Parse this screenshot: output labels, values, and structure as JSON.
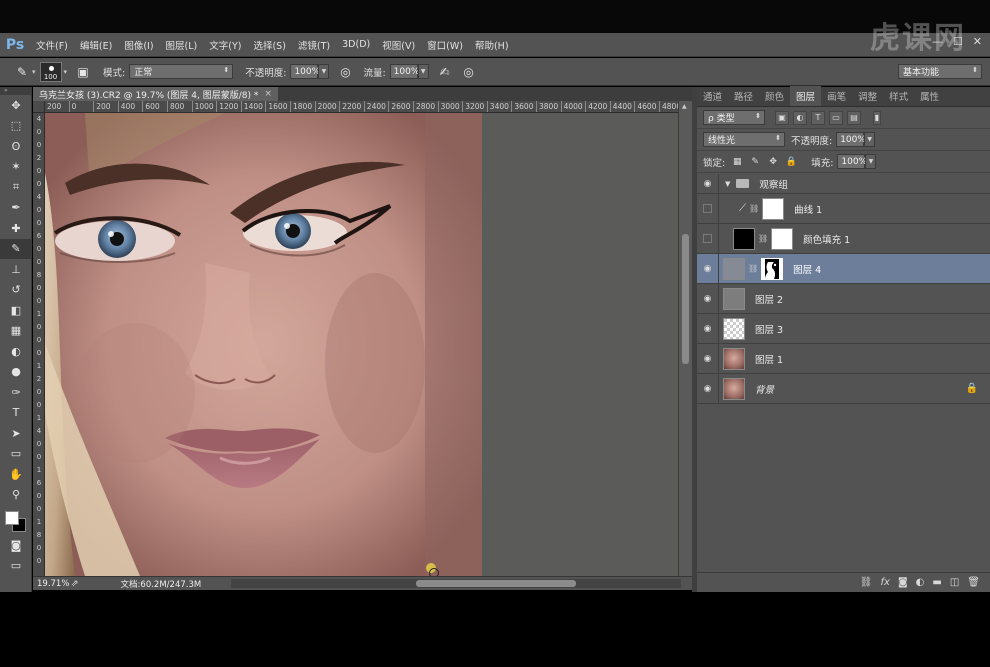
{
  "app": {
    "logo": "Ps"
  },
  "menu": [
    "文件(F)",
    "编辑(E)",
    "图像(I)",
    "图层(L)",
    "文字(Y)",
    "选择(S)",
    "滤镜(T)",
    "3D(D)",
    "视图(V)",
    "窗口(W)",
    "帮助(H)"
  ],
  "watermark": "虎课网",
  "window_controls": [
    "—",
    "☐",
    "✕"
  ],
  "options": {
    "brush_size": "100",
    "mode_label": "模式:",
    "mode_value": "正常",
    "opacity_label": "不透明度:",
    "opacity_value": "100%",
    "flow_label": "流量:",
    "flow_value": "100%",
    "workspace": "基本功能"
  },
  "document": {
    "tab_title": "乌克兰女孩 (3).CR2 @ 19.7% (图层 4, 图层蒙版/8) *",
    "close": "×",
    "ruler_top": [
      "200",
      "0",
      "200",
      "400",
      "600",
      "800",
      "1000",
      "1200",
      "1400",
      "1600",
      "1800",
      "2000",
      "2200",
      "2400",
      "2600",
      "2800",
      "3000",
      "3200",
      "3400",
      "3600",
      "3800",
      "4000",
      "4200",
      "4400",
      "4600",
      "4800"
    ],
    "ruler_left": [
      "4",
      "0",
      "0",
      "2",
      "0",
      "0",
      "4",
      "0",
      "0",
      "6",
      "0",
      "0",
      "8",
      "0",
      "0",
      "1",
      "0",
      "0",
      "0",
      "1",
      "2",
      "0",
      "0",
      "1",
      "4",
      "0",
      "0",
      "1",
      "6",
      "0",
      "0",
      "1",
      "8",
      "0",
      "0"
    ],
    "zoom": "19.71%",
    "doc_info": "文档:60.2M/247.3M"
  },
  "tools": [
    "move-tool",
    "marquee-tool",
    "lasso-tool",
    "magic-wand-tool",
    "crop-tool",
    "eyedropper-tool",
    "healing-brush-tool",
    "brush-tool",
    "clone-stamp-tool",
    "history-brush-tool",
    "eraser-tool",
    "gradient-tool",
    "blur-tool",
    "dodge-tool",
    "pen-tool",
    "type-tool",
    "path-selection-tool",
    "shape-tool",
    "hand-tool",
    "zoom-tool"
  ],
  "tool_glyphs": [
    "✥",
    "⬚",
    "ʘ",
    "✶",
    "⌗",
    "✒",
    "✚",
    "✎",
    "⊥",
    "↺",
    "◧",
    "▦",
    "◐",
    "●",
    "✑",
    "T",
    "➤",
    "▭",
    "✋",
    "⚲"
  ],
  "panel": {
    "tabs": [
      "通道",
      "路径",
      "颜色",
      "图层",
      "画笔",
      "调整",
      "样式",
      "属性"
    ],
    "active_tab": "图层",
    "filter_kind": "ρ 类型",
    "blend_mode": "线性光",
    "opacity_label": "不透明度:",
    "opacity_value": "100%",
    "lock_label": "锁定:",
    "fill_label": "填充:",
    "fill_value": "100%",
    "layers": [
      {
        "name": "观察组",
        "visible": true,
        "type": "group"
      },
      {
        "name": "曲线 1",
        "visible": false,
        "type": "adjustment"
      },
      {
        "name": "颜色填充 1",
        "visible": false,
        "type": "fill"
      },
      {
        "name": "图层 4",
        "visible": true,
        "type": "masked",
        "selected": true
      },
      {
        "name": "图层 2",
        "visible": true,
        "type": "gray"
      },
      {
        "name": "图层 3",
        "visible": true,
        "type": "transparent"
      },
      {
        "name": "图层 1",
        "visible": true,
        "type": "photo"
      },
      {
        "name": "背景",
        "visible": true,
        "type": "background",
        "locked": true
      }
    ],
    "bottom_icons": [
      "link-icon",
      "fx-icon",
      "mask-icon",
      "adjustment-icon",
      "folder-icon",
      "new-layer-icon",
      "trash-icon"
    ]
  },
  "colors": {
    "accent_selected": "#6c7e9a",
    "panel": "#535353",
    "canvas_bg": "#5b5c5a"
  }
}
